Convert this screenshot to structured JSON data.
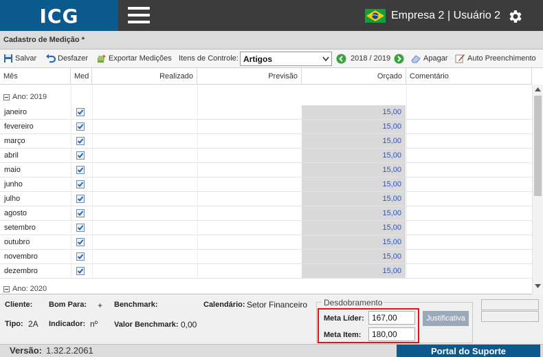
{
  "header": {
    "logo": "ICG",
    "company": "Empresa 2",
    "user": "| Usuário 2"
  },
  "title": "Cadastro de Medição *",
  "toolbar": {
    "save": "Salvar",
    "undo": "Desfazer",
    "export": "Exportar Medições",
    "items_label": "Itens de Controle:",
    "items_value": "Artigos",
    "period": "2018 / 2019",
    "delete": "Apagar",
    "autofill": "Auto Preenchimento"
  },
  "columns": {
    "mes": "Mês",
    "med": "Med",
    "realizado": "Realizado",
    "previsao": "Previsão",
    "orcado": "Orçado",
    "comentario": "Comentário"
  },
  "groups": [
    {
      "label": "Ano: 2019",
      "rows": [
        {
          "mes": "janeiro",
          "med": true,
          "orcado": "15,00"
        },
        {
          "mes": "fevereiro",
          "med": true,
          "orcado": "15,00"
        },
        {
          "mes": "março",
          "med": true,
          "orcado": "15,00"
        },
        {
          "mes": "abril",
          "med": true,
          "orcado": "15,00"
        },
        {
          "mes": "maio",
          "med": true,
          "orcado": "15,00"
        },
        {
          "mes": "junho",
          "med": true,
          "orcado": "15,00"
        },
        {
          "mes": "julho",
          "med": true,
          "orcado": "15,00"
        },
        {
          "mes": "agosto",
          "med": true,
          "orcado": "15,00"
        },
        {
          "mes": "setembro",
          "med": true,
          "orcado": "15,00"
        },
        {
          "mes": "outubro",
          "med": true,
          "orcado": "15,00"
        },
        {
          "mes": "novembro",
          "med": true,
          "orcado": "15,00"
        },
        {
          "mes": "dezembro",
          "med": true,
          "orcado": "15,00"
        }
      ]
    },
    {
      "label": "Ano: 2020",
      "rows": []
    }
  ],
  "info": {
    "cliente_label": "Cliente:",
    "bompara_label": "Bom Para:",
    "bompara_value": "+",
    "benchmark_label": "Benchmark:",
    "calendario_label": "Calendário:",
    "calendario_value": "Setor Financeiro",
    "tipo_label": "Tipo:",
    "tipo_value": "2A",
    "indicador_label": "Indicador:",
    "indicador_value": "nº",
    "valor_benchmark_label": "Valor Benchmark:",
    "valor_benchmark_value": "0,00",
    "desdobramento": "Desdobramento",
    "meta_lider_label": "Meta Líder:",
    "meta_lider_value": "167,00",
    "meta_item_label": "Meta Item:",
    "meta_item_value": "180,00",
    "justificativa": "Justificativa"
  },
  "footer": {
    "version_label": "Versão:",
    "version_value": "1.32.2.2061",
    "portal": "Portal do Suporte"
  },
  "colors": {
    "brand_blue": "#0b5a8e",
    "header_dark": "#3c3c3c",
    "highlight_red": "#e0141e",
    "value_blue": "#2a52be"
  },
  "icons": [
    "menu-icon",
    "brazil-flag-icon",
    "gear-icon",
    "save-icon",
    "undo-icon",
    "export-icon",
    "prev-arrow-icon",
    "next-arrow-icon",
    "eraser-icon",
    "autofill-icon"
  ]
}
